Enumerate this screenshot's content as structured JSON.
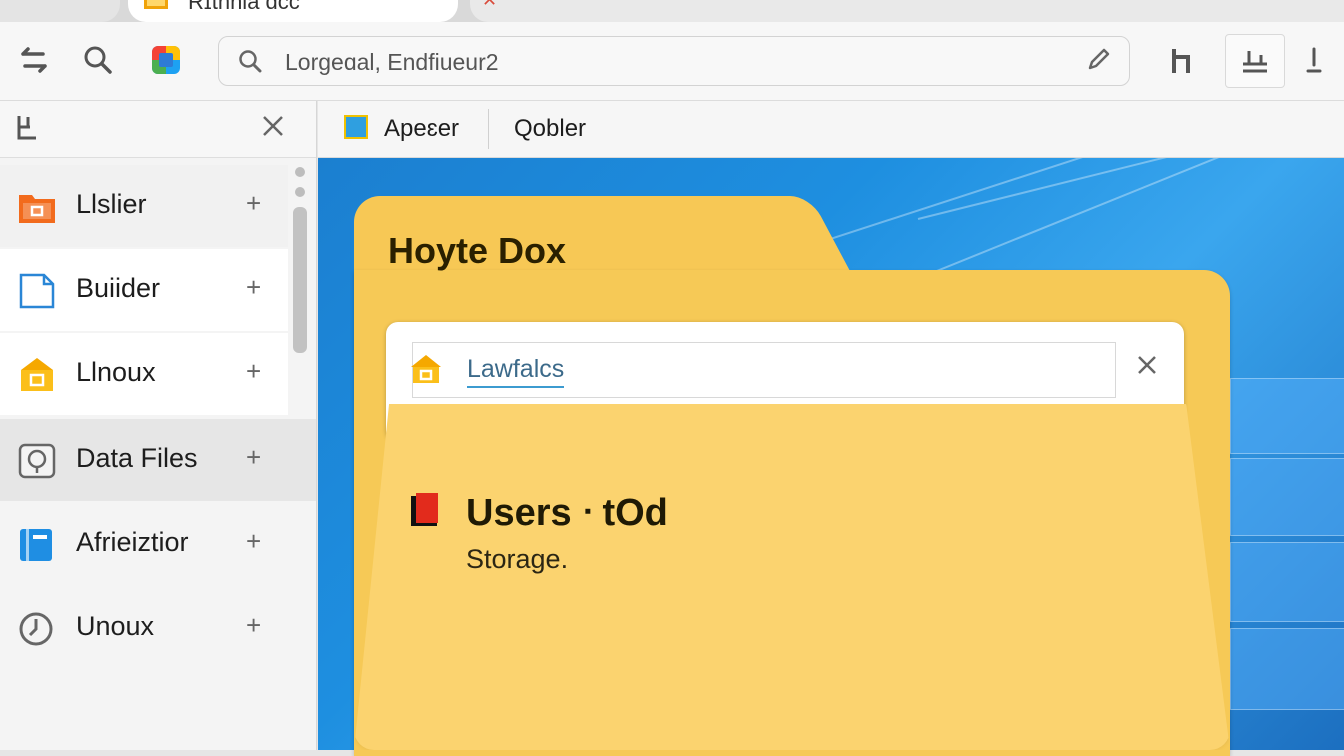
{
  "tabs": {
    "active_label": "Rɪthnia dcc"
  },
  "toolbar": {
    "address_text": "Lorgeɑal, Endfiueur2"
  },
  "sidebar": {
    "items": [
      {
        "label": "Llslier",
        "icon": "orange-folder-icon"
      },
      {
        "label": "Buiider",
        "icon": "document-icon"
      },
      {
        "label": "Llnoux",
        "icon": "yellow-folder-icon"
      },
      {
        "label": "Data Files",
        "icon": "disk-icon"
      },
      {
        "label": "Afrieiztior",
        "icon": "blue-book-icon"
      },
      {
        "label": "Unoux",
        "icon": "clock-icon"
      }
    ],
    "plus": "+"
  },
  "content_header": {
    "item1": "Apeɛer",
    "item2": "Qobler"
  },
  "folder": {
    "title": "Hoyte Dox",
    "field_text": "Lawfalcs",
    "card_title": "Users ᐧ tOd",
    "card_subtitle": "Storage."
  },
  "colors": {
    "folder": "#f6c956",
    "desktop": "#1e8fe0"
  }
}
